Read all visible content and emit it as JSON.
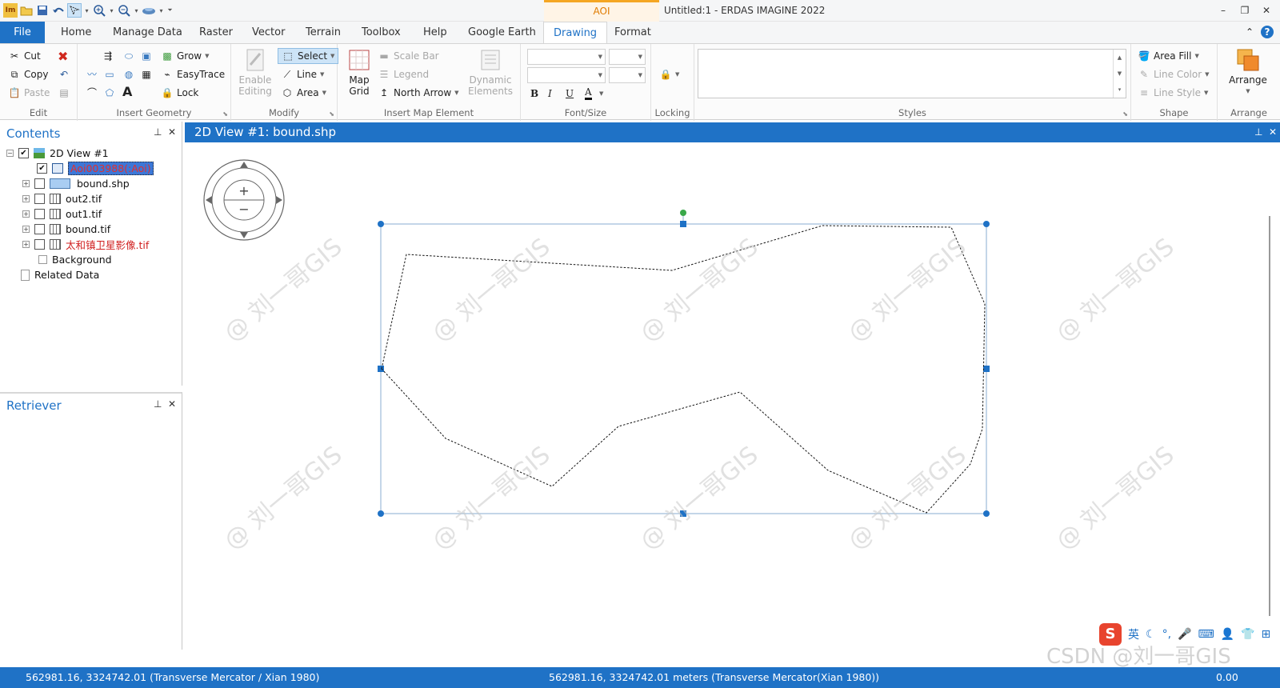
{
  "window": {
    "title": "Untitled:1 - ERDAS IMAGINE 2022",
    "context_tab": "AOI",
    "controls": {
      "minimize": "–",
      "restore": "❐",
      "close": "✕"
    }
  },
  "quick_access": [
    "app-icon",
    "open-icon",
    "save-icon",
    "undo-icon",
    "select-icon",
    "zoom-in-icon",
    "zoom-out-icon",
    "pan-icon"
  ],
  "tabs": {
    "file": "File",
    "items": [
      "Home",
      "Manage Data",
      "Raster",
      "Vector",
      "Terrain",
      "Toolbox",
      "Help",
      "Google Earth",
      "Drawing",
      "Format"
    ],
    "active": "Drawing"
  },
  "ribbon": {
    "edit": {
      "label": "Edit",
      "cut": "Cut",
      "copy": "Copy",
      "paste": "Paste"
    },
    "insert_geometry": {
      "label": "Insert Geometry",
      "grow": "Grow",
      "easytrace": "EasyTrace",
      "lock": "Lock",
      "text_tool": "A"
    },
    "modify": {
      "label": "Modify",
      "enable_editing": "Enable\nEditing",
      "select": "Select",
      "line": "Line",
      "area": "Area"
    },
    "insert_map_element": {
      "label": "Insert Map Element",
      "map_grid": "Map\nGrid",
      "scale_bar": "Scale Bar",
      "legend": "Legend",
      "north_arrow": "North Arrow",
      "dynamic_elements": "Dynamic\nElements"
    },
    "font_size": {
      "label": "Font/Size",
      "bold": "B",
      "italic": "I",
      "underline": "U",
      "color": "A"
    },
    "locking": {
      "label": "Locking"
    },
    "styles": {
      "label": "Styles"
    },
    "shape": {
      "label": "Shape",
      "area_fill": "Area Fill",
      "line_color": "Line  Color",
      "line_style": "Line Style"
    },
    "arrange": {
      "label": "Arrange",
      "arrange_btn": "Arrange"
    }
  },
  "contents": {
    "title": "Contents",
    "pin": "📌",
    "close": "✕",
    "root": "2D View #1",
    "layers": [
      {
        "name": "Aoi003988(:Aoi)",
        "checked": true,
        "selected": true
      },
      {
        "name": "bound.shp",
        "checked": false
      },
      {
        "name": "out2.tif",
        "checked": false
      },
      {
        "name": "out1.tif",
        "checked": false
      },
      {
        "name": "bound.tif",
        "checked": false
      },
      {
        "name": "太和镇卫星影像.tif",
        "checked": false
      }
    ],
    "background": "Background",
    "related_data": "Related Data"
  },
  "retriever": {
    "title": "Retriever"
  },
  "view": {
    "title": "2D View #1: bound.shp",
    "zoom_in": "+",
    "zoom_out": "−"
  },
  "status": {
    "left": "562981.16, 3324742.01   (Transverse Mercator / Xian 1980)",
    "center": "562981.16, 3324742.01 meters (Transverse Mercator(Xian 1980))",
    "right": "0.00"
  },
  "ime": {
    "lang": "英"
  },
  "watermarks": [
    "@ 刘一哥GIS",
    "CSDN @刘一哥GIS"
  ],
  "colors": {
    "accent": "#1f72c6",
    "context_orange": "#f5a623",
    "aoi_text": "#e03030"
  }
}
